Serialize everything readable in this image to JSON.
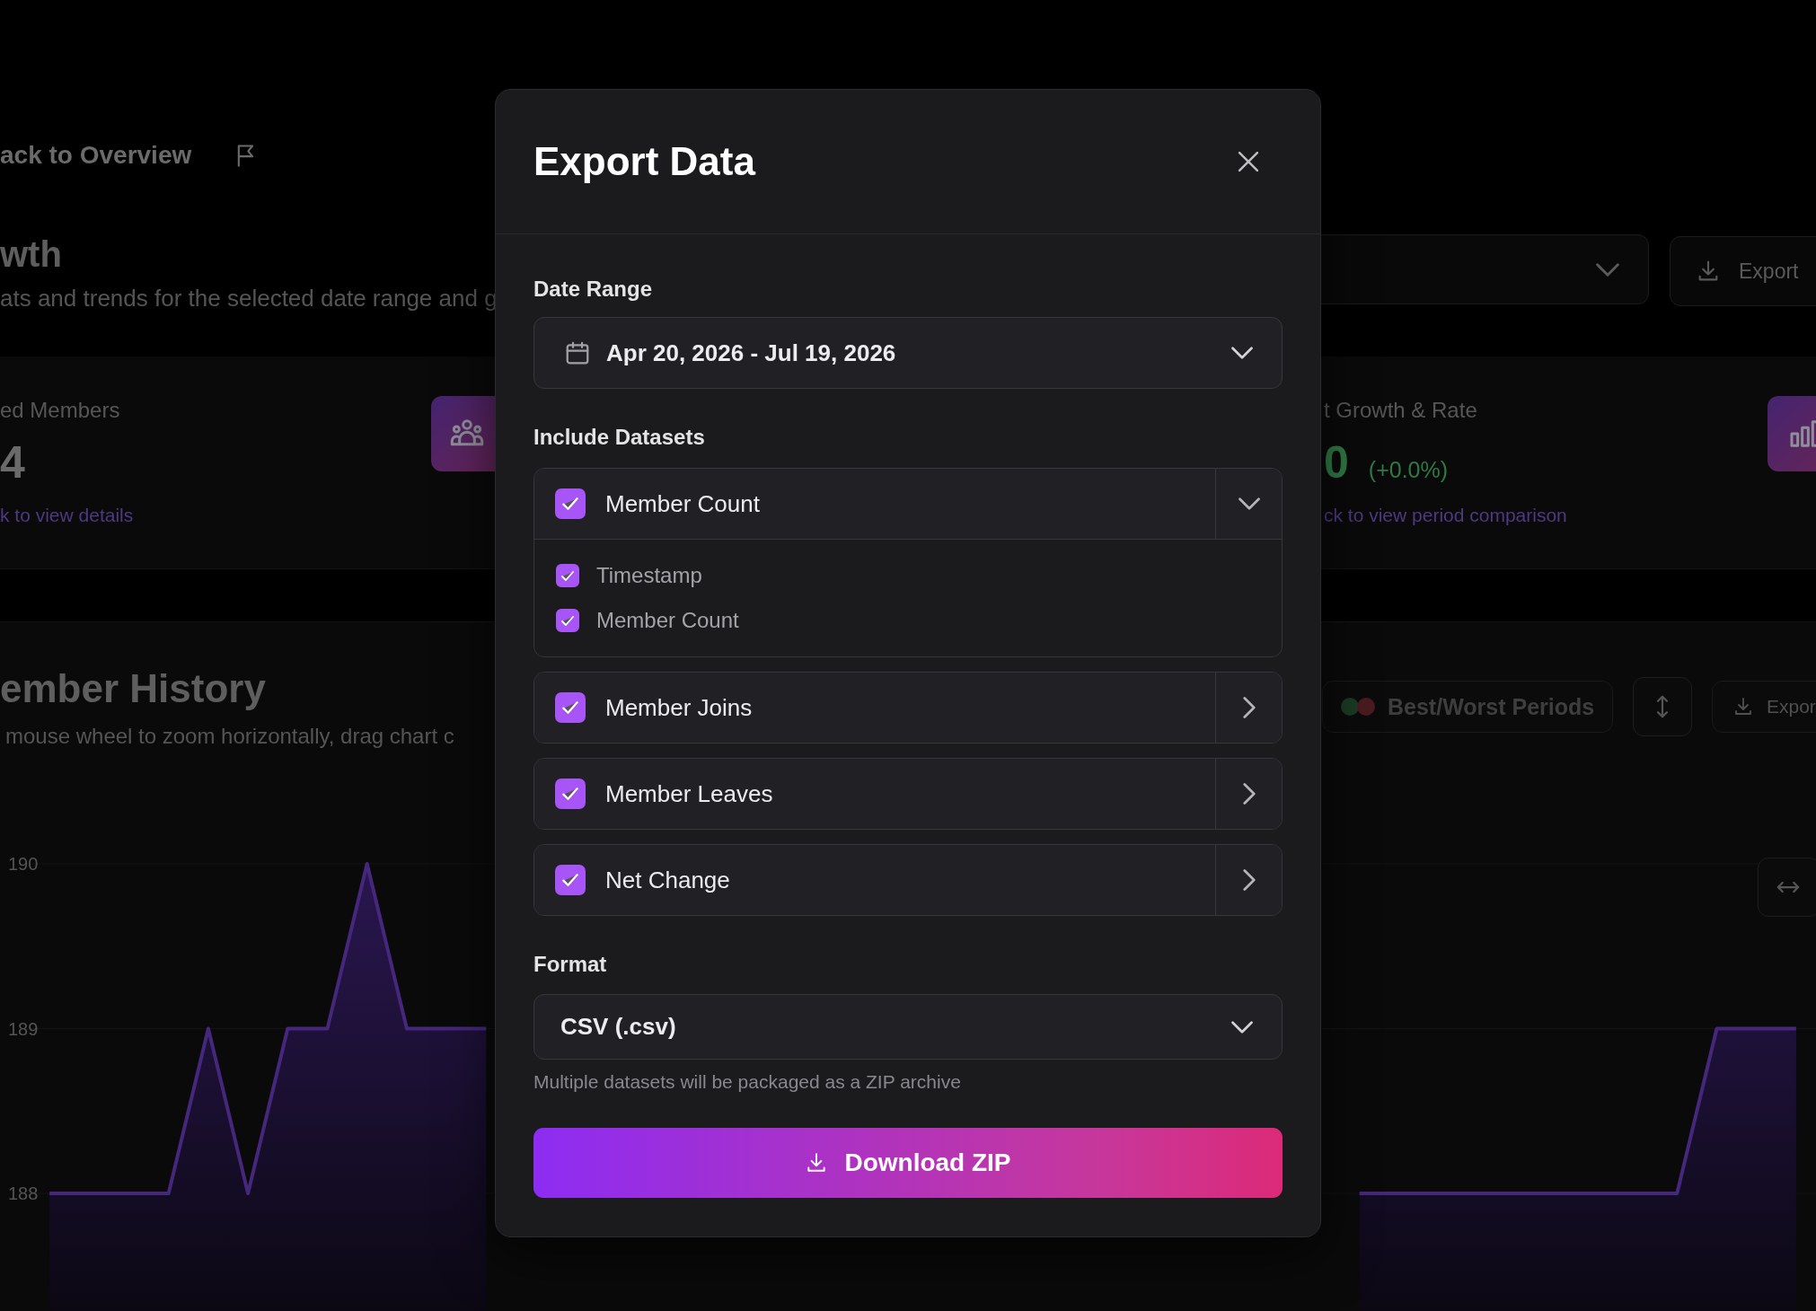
{
  "back_link": {
    "label": "ack to Overview"
  },
  "header": {
    "title": "wth",
    "subtitle": "ats and trends for the selected date range and g",
    "export_button": "Export"
  },
  "stat_cards": [
    {
      "kind": "count",
      "label": "ed Members",
      "value": "4",
      "link": "k to view details"
    },
    {
      "kind": "growth",
      "label": "t Growth & Rate",
      "value": "0",
      "change": "(+0.0%)",
      "link": "ck to view period comparison"
    }
  ],
  "history": {
    "title": "ember History",
    "subtitle": "mouse wheel to zoom horizontally, drag chart c",
    "periods_button": "Best/Worst Periods",
    "export_button": "Expor",
    "chart_data": {
      "type": "area",
      "grid": true,
      "ylim": [
        188,
        190
      ],
      "yticks": [
        188,
        189,
        190
      ],
      "categories": [
        null,
        null,
        null,
        null,
        null,
        null,
        null,
        null,
        null,
        null,
        null,
        null,
        null,
        null,
        null,
        null,
        null,
        null,
        null,
        null,
        null,
        null,
        null,
        null,
        null,
        null,
        null,
        null,
        null,
        null,
        null,
        null,
        null,
        null,
        null,
        null,
        null,
        null,
        null,
        null,
        null,
        null,
        null,
        null,
        null
      ],
      "series": [
        {
          "color": "#45277c",
          "values": [
            188,
            188,
            188,
            188,
            189,
            188,
            189,
            189,
            190,
            189,
            189,
            189,
            null,
            null,
            null,
            null,
            null,
            null,
            null,
            null,
            null,
            null,
            null,
            null,
            null,
            null,
            null,
            null,
            null,
            null,
            null,
            null,
            null,
            188,
            188,
            188,
            188,
            188,
            188,
            188,
            188,
            188,
            189,
            189,
            189
          ]
        }
      ]
    }
  },
  "dialog": {
    "title": "Export Data",
    "date_range": {
      "label": "Date Range",
      "value": "Apr 20, 2026 - Jul 19, 2026"
    },
    "datasets_label": "Include Datasets",
    "datasets": [
      {
        "label": "Member Count",
        "checked": true,
        "expanded": true,
        "fields": [
          {
            "label": "Timestamp",
            "checked": true
          },
          {
            "label": "Member Count",
            "checked": true
          }
        ]
      },
      {
        "label": "Member Joins",
        "checked": true,
        "expanded": false
      },
      {
        "label": "Member Leaves",
        "checked": true,
        "expanded": false
      },
      {
        "label": "Net Change",
        "checked": true,
        "expanded": false
      }
    ],
    "format": {
      "label": "Format",
      "value": "CSV (.csv)",
      "hint": "Multiple datasets will be packaged as a ZIP archive"
    },
    "download_button": "Download ZIP"
  }
}
